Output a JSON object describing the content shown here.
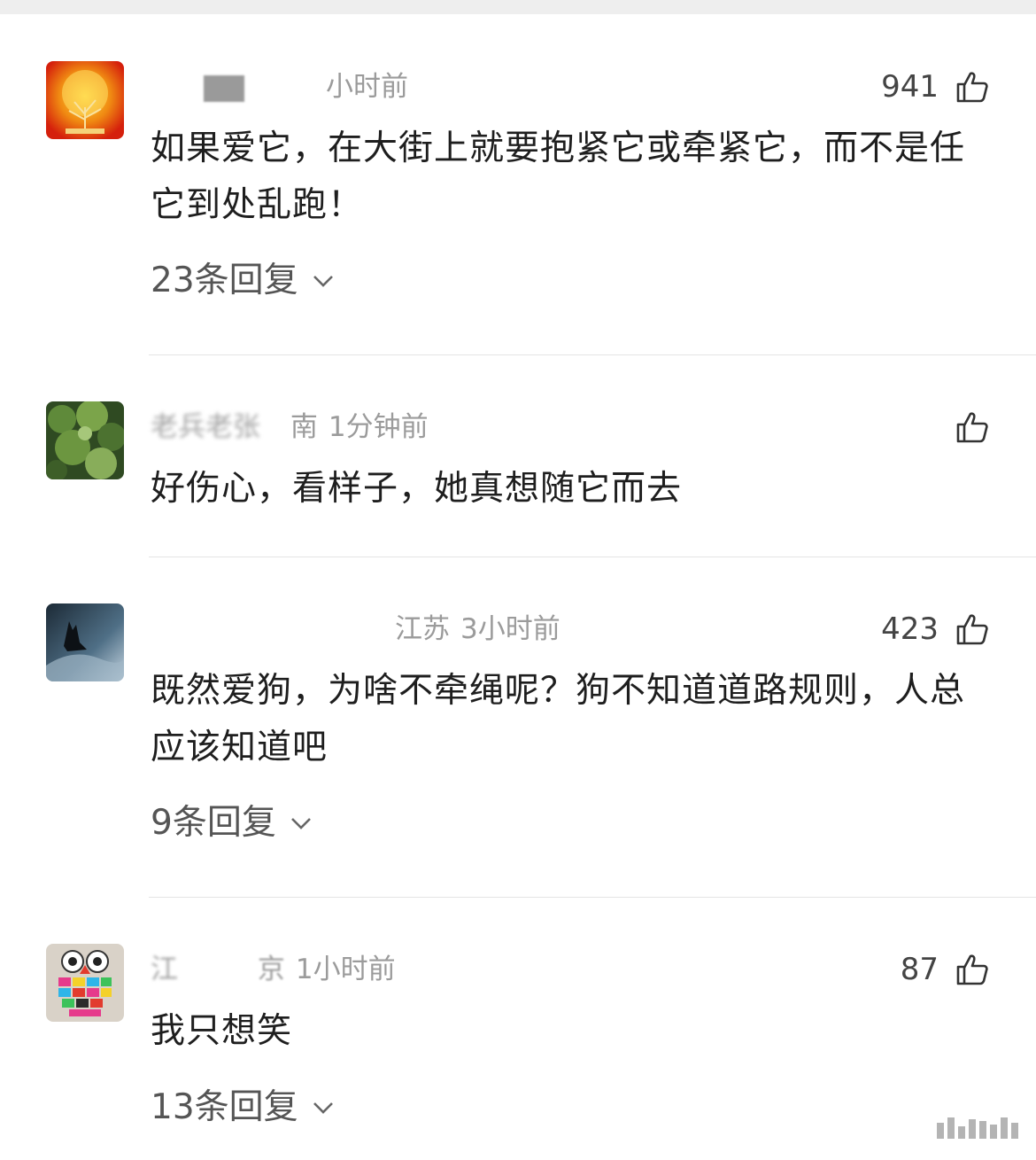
{
  "comments": [
    {
      "user": "",
      "location": "",
      "time": "小时前",
      "likes": "941",
      "text": "如果爱它，在大街上就要抱紧它或牵紧它，而不是任它到处乱跑！",
      "replies": "23条回复",
      "avatar": "golden-tree"
    },
    {
      "user": "老兵老张",
      "location": "南",
      "time": "1分钟前",
      "likes": "",
      "text": "好伤心，看样子，她真想随它而去",
      "replies": "",
      "avatar": "green-foliage"
    },
    {
      "user": "",
      "location": "江苏",
      "time": "3小时前",
      "likes": "423",
      "text": "既然爱狗，为啥不牵绳呢？狗不知道道路规则，人总应该知道吧",
      "replies": "9条回复",
      "avatar": "dark-wolf"
    },
    {
      "user": "江",
      "location": "京",
      "time": "1小时前",
      "likes": "87",
      "text": "我只想笑",
      "replies": "13条回复",
      "avatar": "colorful-owl"
    }
  ],
  "icons": {
    "like": "thumbs-up-icon",
    "expand": "chevron-down-icon"
  }
}
